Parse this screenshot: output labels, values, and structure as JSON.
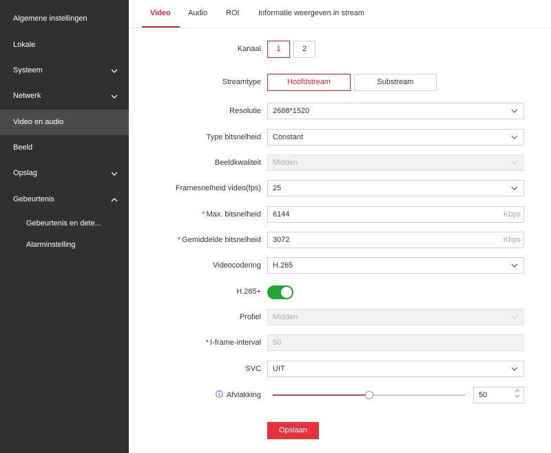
{
  "sidebar": {
    "items": [
      {
        "label": "Algemene instellingen"
      },
      {
        "label": "Lokale"
      },
      {
        "label": "Systeem"
      },
      {
        "label": "Netwerk"
      },
      {
        "label": "Video en audio"
      },
      {
        "label": "Beeld"
      },
      {
        "label": "Opslag"
      },
      {
        "label": "Gebeurtenis"
      }
    ],
    "sub_items": [
      {
        "label": "Gebeurtenis en dete..."
      },
      {
        "label": "Alarminstelling"
      }
    ]
  },
  "tabs": [
    {
      "label": "Video"
    },
    {
      "label": "Audio"
    },
    {
      "label": "ROI"
    },
    {
      "label": "Informatie weergeven in stream"
    }
  ],
  "form": {
    "kanaal": {
      "label": "Kanaal",
      "options": [
        "1",
        "2"
      ]
    },
    "streamtype": {
      "label": "Streamtype",
      "options": [
        "Hoofdstream",
        "Substream"
      ]
    },
    "resolutie": {
      "label": "Resolutie",
      "value": "2688*1520"
    },
    "type_bitsnelheid": {
      "label": "Type bitsnelheid",
      "value": "Constant"
    },
    "beeldkwaliteit": {
      "label": "Beeldkwaliteit",
      "value": "Midden"
    },
    "framesnelheid": {
      "label": "Framesnelheid video(fps)",
      "value": "25"
    },
    "max_bitsnelheid": {
      "required": "*",
      "label": "Max. bitsnelheid",
      "value": "6144",
      "unit": "Kbps"
    },
    "gem_bitsnelheid": {
      "required": "*",
      "label": "Gemiddelde bitsnelheid",
      "value": "3072",
      "unit": "Kbps"
    },
    "videocodering": {
      "label": "Videocodering",
      "value": "H.265"
    },
    "h265plus": {
      "label": "H.265+"
    },
    "profiel": {
      "label": "Profiel",
      "value": "Midden"
    },
    "iframe": {
      "required": "*",
      "label": "I-frame-interval",
      "value": "50"
    },
    "svc": {
      "label": "SVC",
      "value": "UIT"
    },
    "afvlakking": {
      "label": "Afvlakking",
      "value": "50"
    }
  },
  "save_label": "Opslaan",
  "colors": {
    "accent": "#d6232b",
    "toggle_on": "#1ea830",
    "sidebar": "#303030"
  }
}
